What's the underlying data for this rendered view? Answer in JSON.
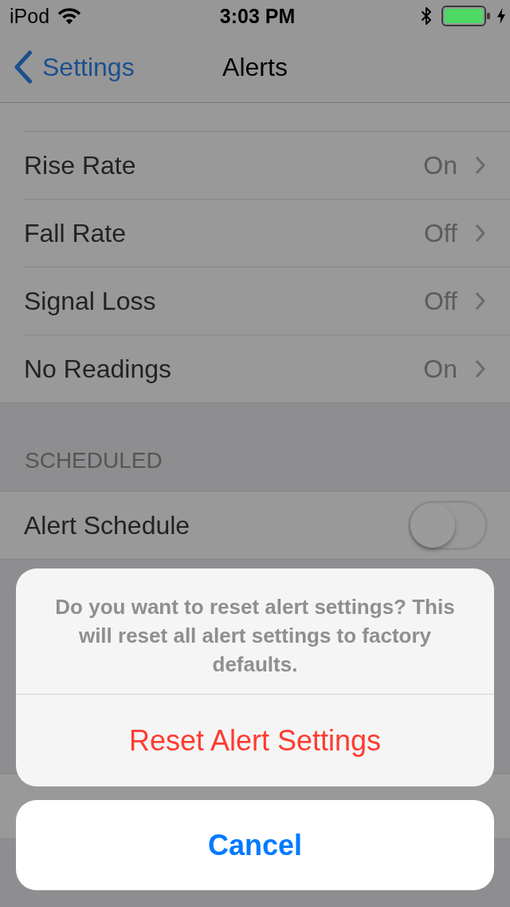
{
  "status_bar": {
    "carrier": "iPod",
    "time": "3:03 PM"
  },
  "nav_bar": {
    "back_label": "Settings",
    "title": "Alerts"
  },
  "sections": [
    {
      "rows": [
        {
          "kind": "disclosure",
          "label": "Rise Rate",
          "value": "On"
        },
        {
          "kind": "disclosure",
          "label": "Fall Rate",
          "value": "Off"
        },
        {
          "kind": "disclosure",
          "label": "Signal Loss",
          "value": "Off"
        },
        {
          "kind": "disclosure",
          "label": "No Readings",
          "value": "On"
        }
      ]
    },
    {
      "header": "SCHEDULED",
      "rows": [
        {
          "kind": "toggle",
          "label": "Alert Schedule",
          "on": false
        }
      ]
    }
  ],
  "action_sheet": {
    "message": "Do you want to reset alert settings? This will reset all alert settings to factory defaults.",
    "actions": [
      {
        "label": "Reset Alert Settings",
        "kind": "destructive"
      }
    ],
    "cancel": "Cancel"
  }
}
